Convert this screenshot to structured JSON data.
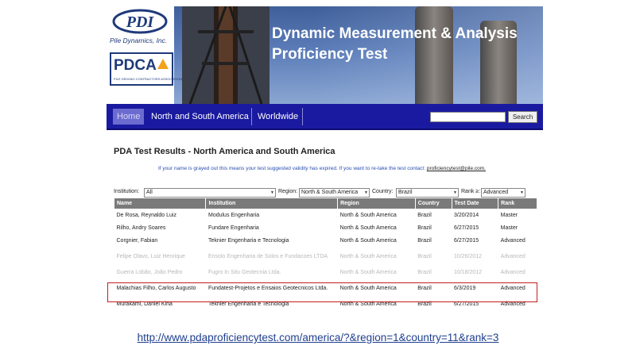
{
  "banner": {
    "company_name": "Pile Dynamics, Inc.",
    "pdi_logo_text": "PDI",
    "pdca_logo_text": "PDCA",
    "pdca_subtitle": "PILE DRIVING CONTRACTORS ASSOCIATION",
    "title_line1": "Dynamic Measurement & Analysis",
    "title_line2": "Proficiency Test"
  },
  "nav": {
    "items": [
      {
        "label": "Home"
      },
      {
        "label": "North and South America"
      },
      {
        "label": "Worldwide"
      }
    ],
    "search_value": "",
    "search_button": "Search"
  },
  "page": {
    "heading": "PDA Test Results - North America and South America",
    "notice": "If your name is grayed out this means your test suggested validity has expired. If you want to re-take the test contact:",
    "contact_email": "proficiencytest@pile.com."
  },
  "filters": {
    "institution_label": "Institution:",
    "institution_value": "All",
    "region_label": "Region:",
    "region_value": "North & South America",
    "country_label": "Country:",
    "country_value": "Brazil",
    "rank_label": "Rank ≥:",
    "rank_value": "Advanced"
  },
  "table": {
    "headers": [
      "Name",
      "Institution",
      "Region",
      "Country",
      "Test Date",
      "Rank"
    ],
    "rows": [
      {
        "name": "De Rosa, Reynaldo Luiz",
        "institution": "Modulus Engenharia",
        "region": "North & South America",
        "country": "Brazil",
        "date": "3/20/2014",
        "rank": "Master",
        "expired": false
      },
      {
        "name": "Rilho, Andry Soares",
        "institution": "Fundare Engenharia",
        "region": "North & South America",
        "country": "Brazil",
        "date": "6/27/2015",
        "rank": "Master",
        "expired": false
      },
      {
        "name": "Corgnier, Fabian",
        "institution": "Teknier Engenharia e Tecnologia",
        "region": "North & South America",
        "country": "Brazil",
        "date": "6/27/2015",
        "rank": "Advanced",
        "expired": false
      },
      {
        "name": "Felipe Olavo, Luiz Henrique",
        "institution": "Ensolo Engenharia de Solos e Fundacoes LTDA",
        "region": "North & South America",
        "country": "Brazil",
        "date": "10/26/2012",
        "rank": "Advanced",
        "expired": true
      },
      {
        "name": "Guerra Lobão, João Pedro",
        "institution": "Fugro In Situ Geotecnia Ltda.",
        "region": "North & South America",
        "country": "Brazil",
        "date": "10/18/2012",
        "rank": "Advanced",
        "expired": true
      },
      {
        "name": "Malachias Filho, Carlos Augusto",
        "institution": "Fundatest-Projetos e Ensaios Geotecnicos Ltda.",
        "region": "North & South America",
        "country": "Brazil",
        "date": "6/3/2019",
        "rank": "Advanced",
        "expired": false
      },
      {
        "name": "Murakami, Daniel Kina",
        "institution": "Teknier Engenharia e Tecnologia",
        "region": "North & South America",
        "country": "Brazil",
        "date": "6/27/2015",
        "rank": "Advanced",
        "expired": false
      }
    ]
  },
  "caption_url": "http://www.pdaproficiencytest.com/america/?&region=1&country=11&rank=3",
  "colors": {
    "nav_bg": "#1a1aa0",
    "highlight_border": "#c41e1e",
    "link": "#1f3f8f"
  }
}
